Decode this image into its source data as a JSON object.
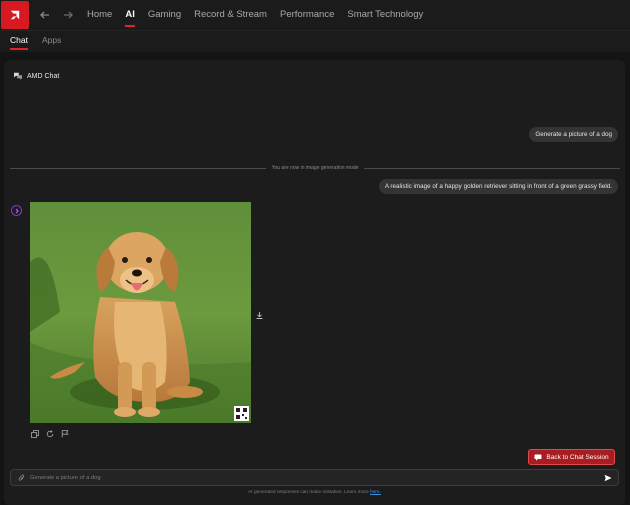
{
  "topnav": {
    "items": [
      "Home",
      "AI",
      "Gaming",
      "Record & Stream",
      "Performance",
      "Smart Technology"
    ],
    "active_index": 1
  },
  "subtabs": {
    "items": [
      "Chat",
      "Apps"
    ],
    "active_index": 0
  },
  "chat": {
    "title": "AMD Chat",
    "user_message_1": "Generate a picture of a dog",
    "mode_notice": "You are now in image generation mode",
    "user_message_2": "A realistic image of a happy golden retriever sitting in front of a green grassy field.",
    "back_button_label": "Back to Chat Session",
    "input_placeholder": "Generate a picture of a dog",
    "disclaimer_text": "AI generated responses can make mistakes. Learn more",
    "disclaimer_link": "here."
  },
  "icons": {
    "logo": "amd-logo",
    "back": "arrow-left-icon",
    "forward": "arrow-right-icon",
    "chat": "chat-bubbles-icon",
    "avatar": "ai-avatar-icon",
    "download": "download-icon",
    "copy": "copy-icon",
    "regenerate": "refresh-icon",
    "report": "flag-icon",
    "attach": "paperclip-icon",
    "send": "send-icon"
  },
  "colors": {
    "accent": "#e0222a",
    "back_button": "#a71d22",
    "link": "#3b8fe0",
    "avatar_ring": "#7a3fbf"
  }
}
